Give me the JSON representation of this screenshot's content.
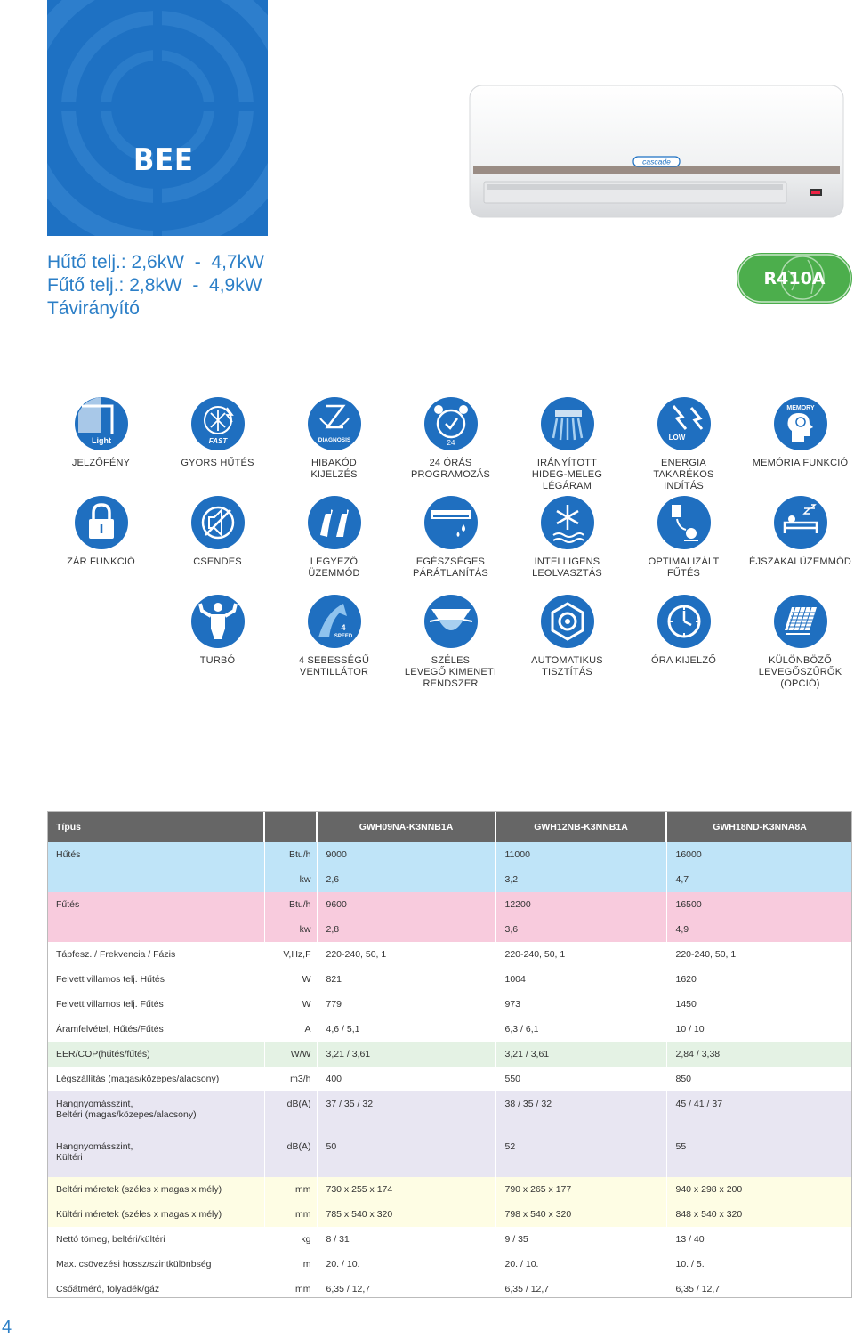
{
  "brand": {
    "series": "BEE",
    "refrigerant": "R410A",
    "logo_text": "cascade"
  },
  "specs": {
    "cooling": "Hűtő telj.: 2,6kW  -  4,7kW",
    "heating": "Fűtő telj.: 2,8kW  -  4,9kW",
    "remote": "Távirányító"
  },
  "features": [
    {
      "label": "JELZŐFÉNY",
      "badge": "Light",
      "icon": "light-icon"
    },
    {
      "label": "GYORS HŰTÉS",
      "badge": "FAST",
      "icon": "fast-cooling-icon"
    },
    {
      "label": "HIBAKÓD\nKIJELZÉS",
      "badge": "DIAGNOSIS",
      "icon": "diagnosis-icon"
    },
    {
      "label": "24 ÓRÁS\nPROGRAMOZÁS",
      "badge": "24",
      "icon": "alarm-clock-icon"
    },
    {
      "label": "IRÁNYÍTOTT\nHIDEG-MELEG\nLÉGÁRAM",
      "badge": "",
      "icon": "airflow-icon"
    },
    {
      "label": "ENERGIA\nTAKARÉKOS\nINDÍTÁS",
      "badge": "LOW",
      "icon": "low-energy-icon"
    },
    {
      "label": "MEMÓRIA FUNKCIÓ",
      "badge": "MEMORY",
      "icon": "memory-icon"
    },
    {
      "label": "ZÁR FUNKCIÓ",
      "badge": "",
      "icon": "lock-icon"
    },
    {
      "label": "CSENDES",
      "badge": "",
      "icon": "silent-icon"
    },
    {
      "label": "LEGYEZŐ\nÜZEMMÓD",
      "badge": "",
      "icon": "fan-mode-icon"
    },
    {
      "label": "EGÉSZSÉGES\nPÁRÁTLANÍTÁS",
      "badge": "",
      "icon": "dehumidify-icon"
    },
    {
      "label": "INTELLIGENS\nLEOLVASZTÁS",
      "badge": "",
      "icon": "defrost-icon"
    },
    {
      "label": "OPTIMALIZÁLT\nFŰTÉS",
      "badge": "",
      "icon": "optimized-heating-icon"
    },
    {
      "label": "ÉJSZAKAI ÜZEMMÓD",
      "badge": "",
      "icon": "night-mode-icon"
    },
    {
      "label": "TURBÓ",
      "badge": "",
      "icon": "turbo-icon"
    },
    {
      "label": "4 SEBESSÉGŰ\nVENTILLÁTOR",
      "badge": "4\nSPEED",
      "icon": "four-speed-icon"
    },
    {
      "label": "SZÉLES\nLEVEGŐ KIMENETI\nRENDSZER",
      "badge": "",
      "icon": "wide-airflow-icon"
    },
    {
      "label": "AUTOMATIKUS\nTISZTÍTÁS",
      "badge": "",
      "icon": "auto-clean-icon"
    },
    {
      "label": "ÓRA KIJELZŐ",
      "badge": "",
      "icon": "clock-display-icon"
    },
    {
      "label": "KÜLÖNBÖZŐ\nLEVEGŐSZŰRŐK\n(OPCIÓ)",
      "badge": "",
      "icon": "air-filter-icon"
    }
  ],
  "table": {
    "header": [
      "Típus",
      "GWH09NA-K3NNB1A",
      "GWH12NB-K3NNB1A",
      "GWH18ND-K3NNA8A"
    ],
    "rows": [
      {
        "label": "Hűtés",
        "unit": "Btu/h",
        "v": [
          "9000",
          "11000",
          "16000"
        ],
        "band": "bl",
        "h": 28
      },
      {
        "label": "",
        "unit": "kw",
        "v": [
          "2,6",
          "3,2",
          "4,7"
        ],
        "band": "bl",
        "h": 28
      },
      {
        "label": "Fűtés",
        "unit": "Btu/h",
        "v": [
          "9600",
          "12200",
          "16500"
        ],
        "band": "pk",
        "h": 28
      },
      {
        "label": "",
        "unit": "kw",
        "v": [
          "2,8",
          "3,6",
          "4,9"
        ],
        "band": "pk",
        "h": 28
      },
      {
        "label": "Tápfesz. / Frekvencia / Fázis",
        "unit": "V,Hz,F",
        "v": [
          "220-240, 50, 1",
          "220-240, 50, 1",
          "220-240, 50, 1"
        ],
        "band": "wh",
        "h": 28
      },
      {
        "label": "Felvett villamos telj. Hűtés",
        "unit": "W",
        "v": [
          "821",
          "1004",
          "1620"
        ],
        "band": "wh",
        "h": 28
      },
      {
        "label": "Felvett villamos telj. Fűtés",
        "unit": "W",
        "v": [
          "779",
          "973",
          "1450"
        ],
        "band": "wh",
        "h": 28
      },
      {
        "label": "Áramfelvétel, Hűtés/Fűtés",
        "unit": "A",
        "v": [
          "4,6 / 5,1",
          "6,3 / 6,1",
          "10 / 10"
        ],
        "band": "wh",
        "h": 28
      },
      {
        "label": "EER/COP(hűtés/fűtés)",
        "unit": "W/W",
        "v": [
          "3,21 / 3,61",
          "3,21 / 3,61",
          "2,84 / 3,38"
        ],
        "band": "gr",
        "h": 28
      },
      {
        "label": "Légszállítás (magas/közepes/alacsony)",
        "unit": "m3/h",
        "v": [
          "400",
          "550",
          "850"
        ],
        "band": "wh",
        "h": 28
      },
      {
        "label": "Hangnyomásszint,\nBeltéri (magas/közepes/alacsony)",
        "unit": "dB(A)",
        "v": [
          "37 / 35 / 32",
          "38 / 35 / 32",
          "45 / 41 / 37"
        ],
        "band": "lv",
        "h": 40
      },
      {
        "label": "Hangnyomásszint,\nKültéri",
        "unit": "dB(A)",
        "v": [
          "50",
          "52",
          "55"
        ],
        "band": "lv",
        "h": 40
      },
      {
        "label": "Beltéri méretek (széles x magas x mély)",
        "unit": "mm",
        "v": [
          "730 x 255 x 174",
          "790 x 265 x 177",
          "940 x 298 x 200"
        ],
        "band": "yl",
        "h": 28
      },
      {
        "label": "Kültéri méretek (széles x magas x mély)",
        "unit": "mm",
        "v": [
          "785 x 540 x 320",
          "798 x 540 x 320",
          "848 x 540 x 320"
        ],
        "band": "yl",
        "h": 28
      },
      {
        "label": "Nettó tömeg, beltéri/kültéri",
        "unit": "kg",
        "v": [
          "8 / 31",
          "9 / 35",
          "13 / 40"
        ],
        "band": "wh",
        "h": 28
      },
      {
        "label": "Max. csövezési hossz/szintkülönbség",
        "unit": "m",
        "v": [
          "20. / 10.",
          "20. / 10.",
          "10. / 5."
        ],
        "band": "wh",
        "h": 28
      },
      {
        "label": "Csőátmérő, folyadék/gáz",
        "unit": "mm",
        "v": [
          "6,35 / 12,7",
          "6,35 / 12,7",
          "6,35 / 12,7"
        ],
        "band": "wh",
        "h": 28
      }
    ]
  },
  "colors": {
    "brand_blue": "#1e71c3",
    "icon_blue": "#1f6fc0",
    "r410a_green": "#4cae4c",
    "header_gray": "#666666"
  },
  "page_number": "4"
}
